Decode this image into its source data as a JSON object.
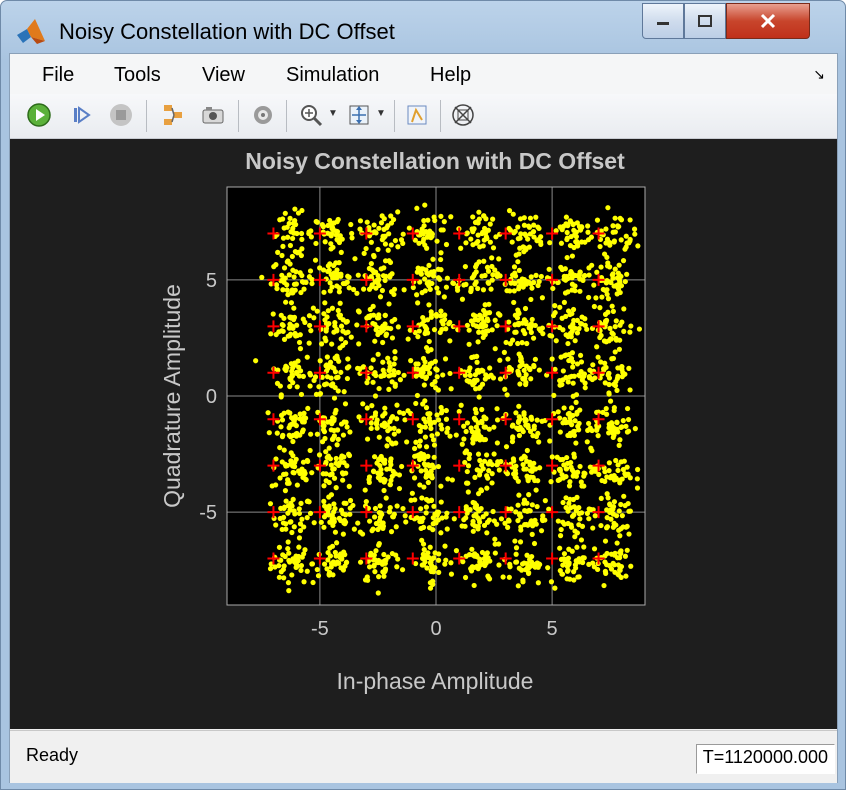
{
  "window": {
    "title": "Noisy Constellation with DC Offset",
    "controls": [
      "minimize-icon",
      "maximize-icon",
      "close-icon"
    ]
  },
  "menu": {
    "items": [
      "File",
      "Tools",
      "View",
      "Simulation",
      "Help"
    ]
  },
  "toolbar": {
    "icons": [
      "run-icon",
      "step-forward-icon",
      "stop-icon",
      "signal-selector-icon",
      "snapshot-icon",
      "settings-icon",
      "zoom-in-icon",
      "dropdown-arrow-icon",
      "autoscale-icon",
      "dropdown-arrow-icon",
      "highlight-icon",
      "reference-constellation-icon"
    ]
  },
  "colors": {
    "plot_background": "#000000",
    "figure_background": "#1e1e1e",
    "axes_text": "#c8c8c8",
    "points": "#ffff00",
    "reference": "#ff0000"
  },
  "chart_data": {
    "type": "scatter",
    "title": "Noisy Constellation with DC Offset",
    "xlabel": "In-phase Amplitude",
    "ylabel": "Quadrature Amplitude",
    "xlim": [
      -9,
      9
    ],
    "ylim": [
      -9,
      9
    ],
    "xticks": [
      -5,
      0,
      5
    ],
    "yticks": [
      -5,
      0,
      5
    ],
    "grid": true,
    "reference_points": {
      "x": [
        -7,
        -5,
        -3,
        -1,
        1,
        3,
        5,
        7
      ],
      "y": [
        -7,
        -5,
        -3,
        -1,
        1,
        3,
        5,
        7
      ],
      "marker": "+"
    },
    "received_clusters": {
      "centers_x": [
        -6.2,
        -4.4,
        -2.4,
        -0.3,
        1.8,
        3.8,
        5.8,
        7.6
      ],
      "centers_y": [
        -7.2,
        -5.2,
        -3.2,
        -1.2,
        1.0,
        3.0,
        5.0,
        7.0
      ],
      "dc_offset": [
        0.6,
        -0.2
      ],
      "spread": 0.45
    }
  },
  "status": {
    "text": "Ready",
    "time": "T=1120000.000"
  }
}
